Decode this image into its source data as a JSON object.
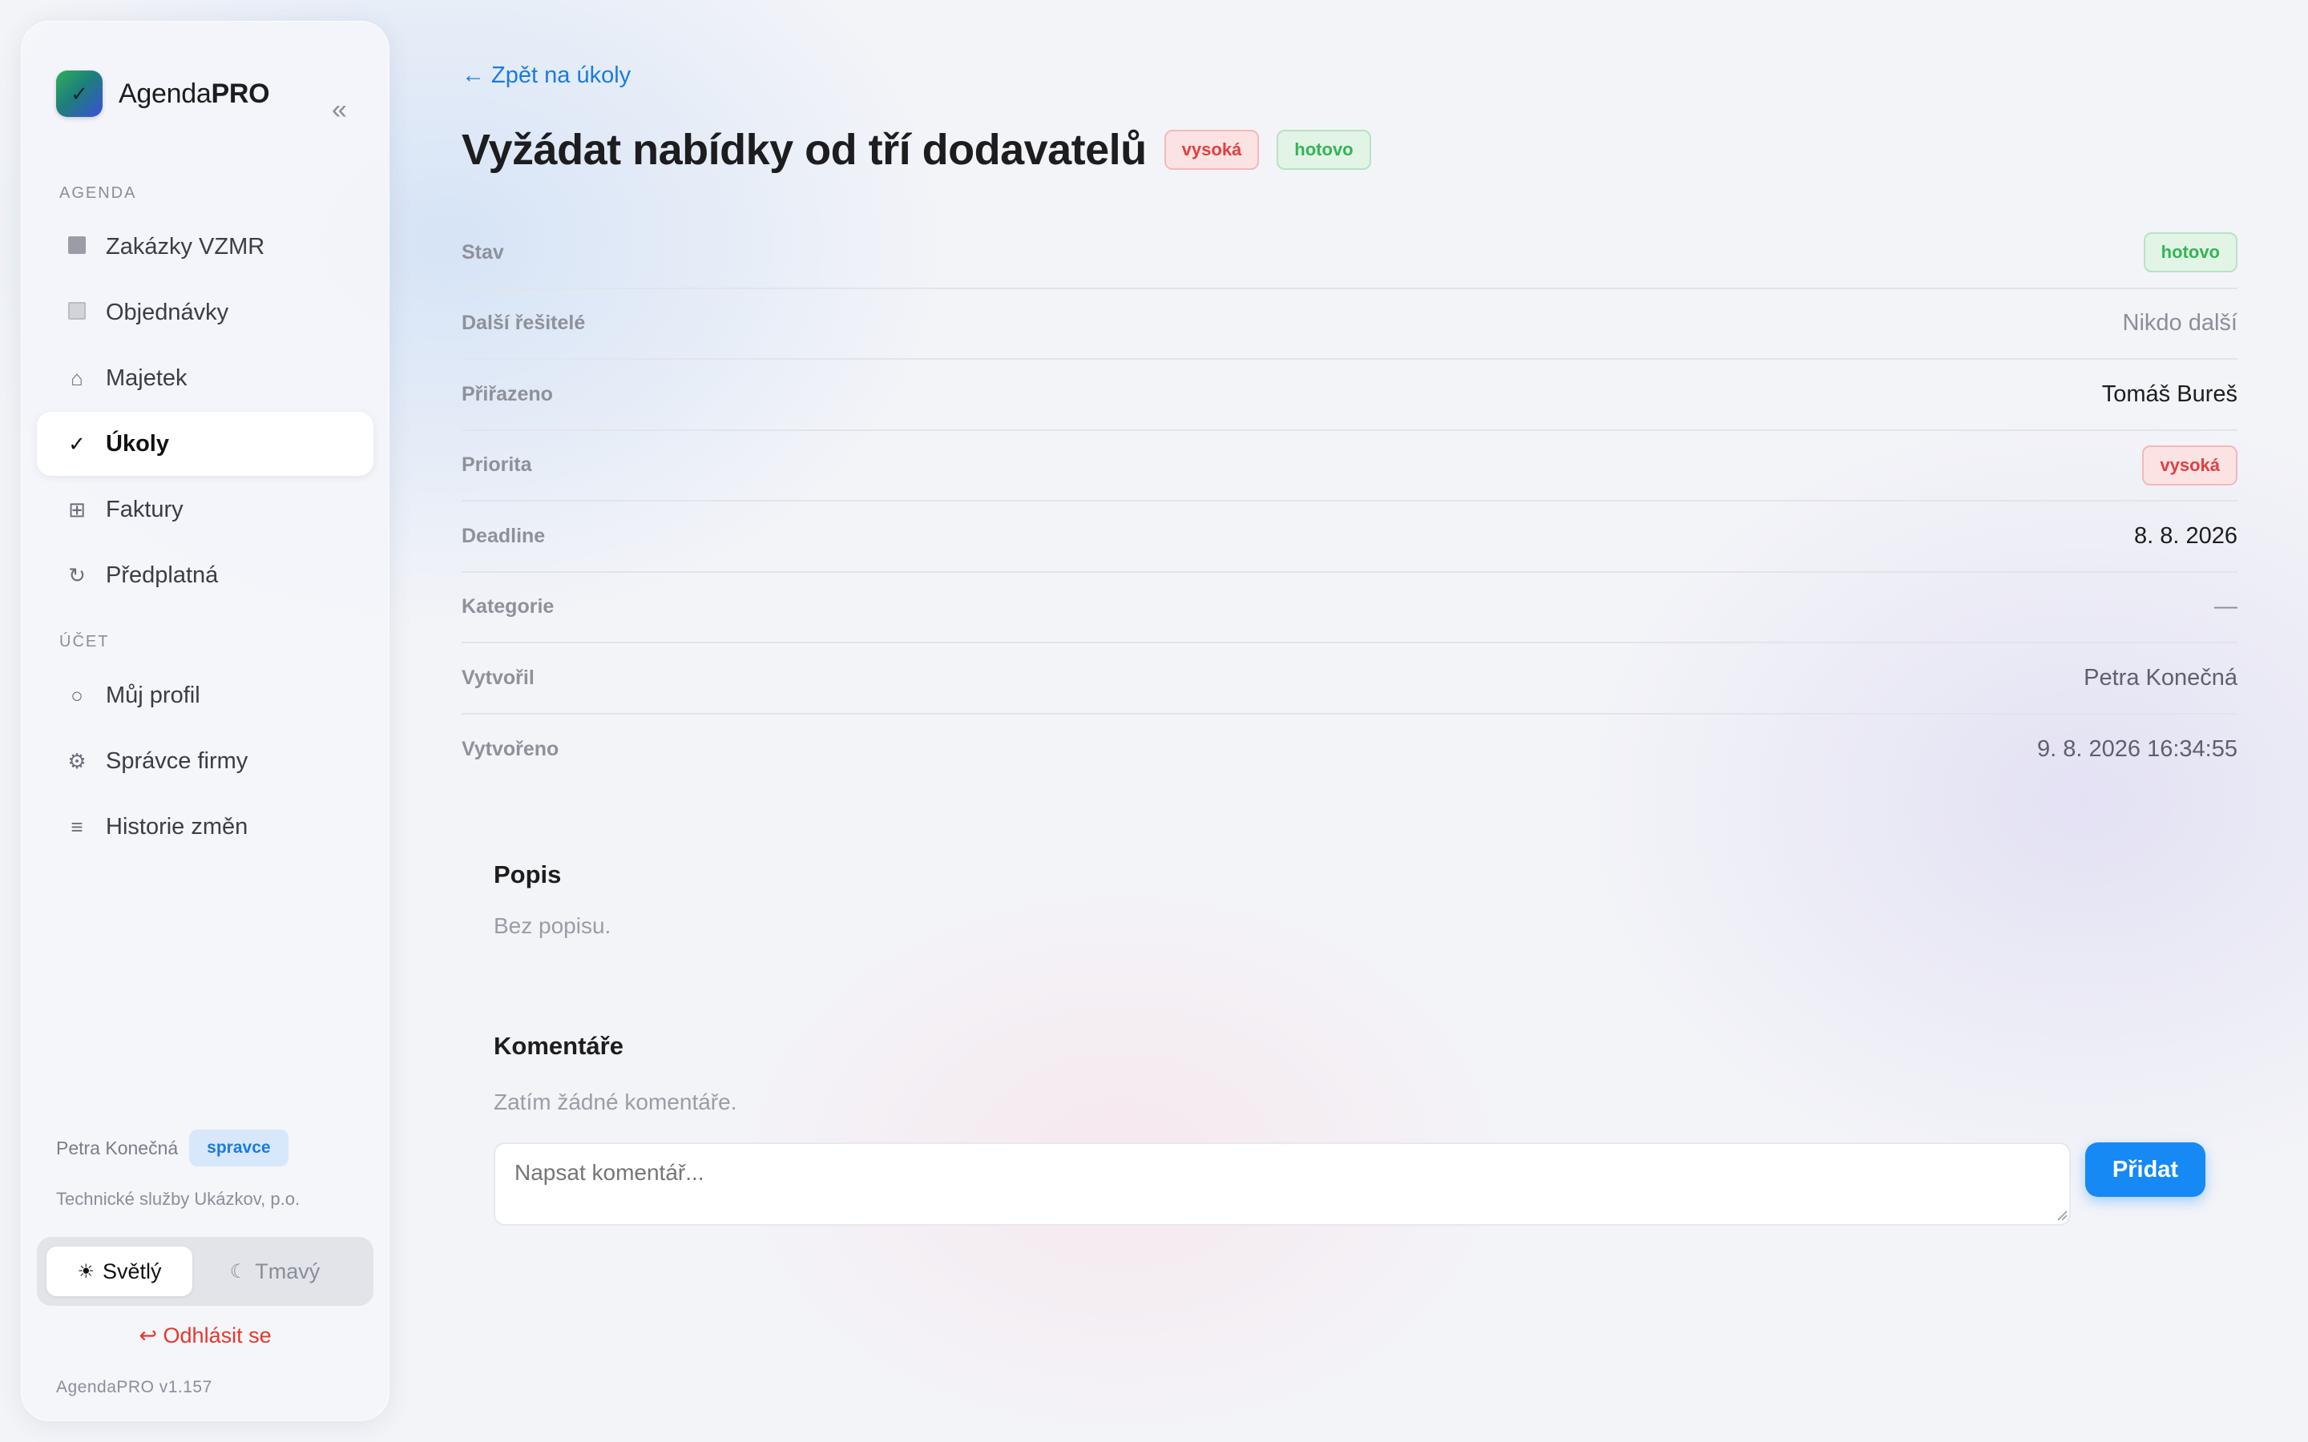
{
  "app": {
    "name_regular": "Agenda",
    "name_bold": "PRO",
    "logo_glyph": "✓",
    "collapse_glyph": "«",
    "version": "AgendaPRO v1.157"
  },
  "sidebar": {
    "section_agenda": "AGENDA",
    "section_account": "ÚČET",
    "agenda_items": [
      {
        "label": "Zakázky VZMR",
        "icon": "square-filled-icon"
      },
      {
        "label": "Objednávky",
        "icon": "square-outline-icon"
      },
      {
        "label": "Majetek",
        "icon": "home-icon"
      },
      {
        "label": "Úkoly",
        "icon": "check-icon",
        "active": true
      },
      {
        "label": "Faktury",
        "icon": "grid-icon"
      },
      {
        "label": "Předplatná",
        "icon": "refresh-icon"
      }
    ],
    "account_items": [
      {
        "label": "Můj profil",
        "icon": "circle-icon"
      },
      {
        "label": "Správce firmy",
        "icon": "gear-icon"
      },
      {
        "label": "Historie změn",
        "icon": "list-icon"
      }
    ],
    "user_name": "Petra Konečná",
    "user_role": "spravce",
    "organization": "Technické služby Ukázkov, p.o.",
    "theme_light": "Světlý",
    "theme_dark": "Tmavý",
    "theme_light_icon": "☀",
    "theme_dark_icon": "☾",
    "logout": "Odhlásit se",
    "logout_icon": "↩"
  },
  "main": {
    "back_link": "← Zpět na úkoly",
    "title": "Vyžádat nabídky od tří dodavatelů",
    "title_priority_badge": "vysoká",
    "title_status_badge": "hotovo",
    "details": {
      "status_label": "Stav",
      "status_value": "hotovo",
      "other_solvers_label": "Další řešitelé",
      "other_solvers_value": "Nikdo další",
      "assigned_label": "Přiřazeno",
      "assigned_value": "Tomáš Bureš",
      "priority_label": "Priorita",
      "priority_value": "vysoká",
      "deadline_label": "Deadline",
      "deadline_value": "8. 8. 2026",
      "category_label": "Kategorie",
      "category_value": "—",
      "created_by_label": "Vytvořil",
      "created_by_value": "Petra Konečná",
      "created_at_label": "Vytvořeno",
      "created_at_value": "9. 8. 2026 16:34:55"
    },
    "description_title": "Popis",
    "description_text": "Bez popisu.",
    "comments_title": "Komentáře",
    "comments_empty": "Zatím žádné komentáře.",
    "comment_placeholder": "Napsat komentář...",
    "add_button": "Přidat"
  },
  "colors": {
    "accent": "#1689f5",
    "danger": "#e5382b",
    "success": "#34b454"
  }
}
